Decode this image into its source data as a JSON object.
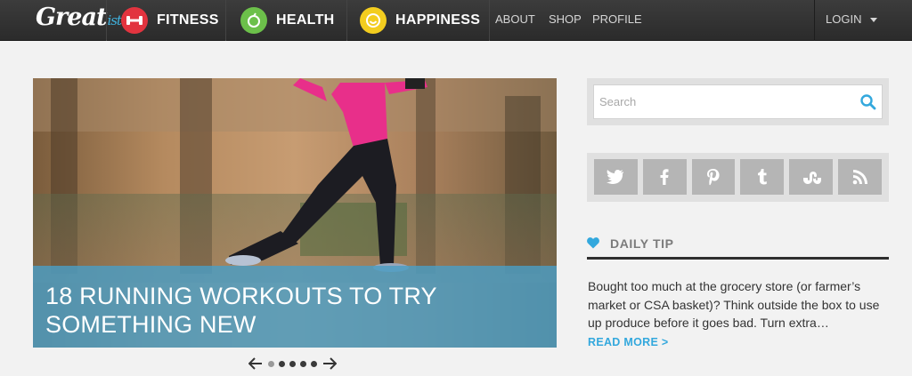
{
  "header": {
    "logo": {
      "main": "Great",
      "suffix": "ist"
    },
    "categories": [
      {
        "label": "FITNESS",
        "icon": "dumbbell-icon",
        "color": "#e2343f"
      },
      {
        "label": "HEALTH",
        "icon": "apple-icon",
        "color": "#6cc04a"
      },
      {
        "label": "HAPPINESS",
        "icon": "smile-icon",
        "color": "#f3cd1f"
      }
    ],
    "links": [
      "ABOUT",
      "SHOP",
      "PROFILE"
    ],
    "login_label": "LOGIN"
  },
  "hero": {
    "title_line1": "18 RUNNING WORKOUTS TO TRY",
    "title_line2": "SOMETHING NEW",
    "slide_count": 5,
    "active_slide": 1,
    "caption_color": "#4a9dc4"
  },
  "sidebar": {
    "search": {
      "placeholder": "Search",
      "value": ""
    },
    "social": [
      "twitter-icon",
      "facebook-icon",
      "pinterest-icon",
      "tumblr-icon",
      "stumbleupon-icon",
      "rss-icon"
    ],
    "daily_tip": {
      "title": "DAILY TIP",
      "text": "Bought too much at the grocery store (or farmer’s market or CSA basket)? Think outside the box to use up produce before it goes bad. Turn extra…",
      "read_more": "READ MORE >"
    }
  },
  "colors": {
    "accent": "#33a8dd",
    "nav_bg": "#333333",
    "page_bg": "#f2f2f2"
  }
}
